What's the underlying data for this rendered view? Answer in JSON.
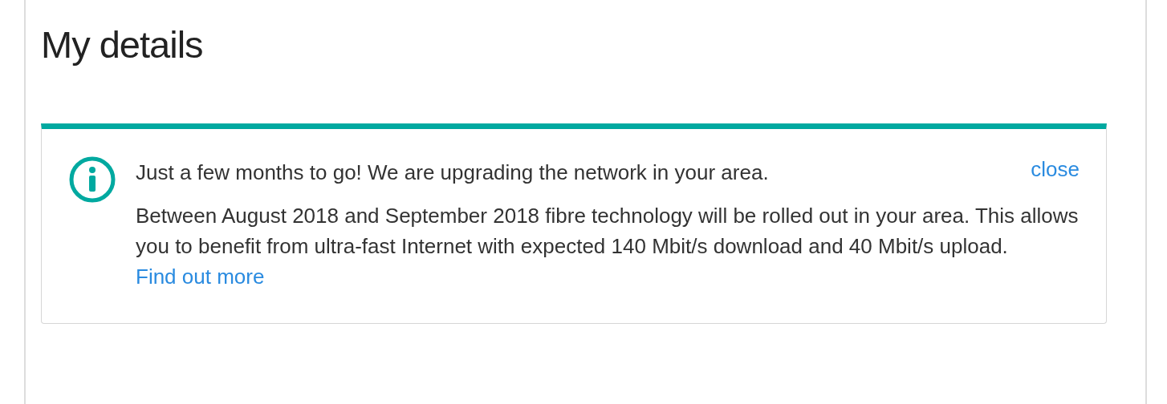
{
  "page": {
    "title": "My details"
  },
  "notice": {
    "headline": "Just a few months to go! We are upgrading the network in your area.",
    "close_label": "close",
    "body": "Between August 2018 and September 2018 fibre technology will be rolled out in your area. This allows you to benefit from ultra-fast Internet with expected 140 Mbit/s download and 40 Mbit/s upload.",
    "link": "Find out more"
  }
}
